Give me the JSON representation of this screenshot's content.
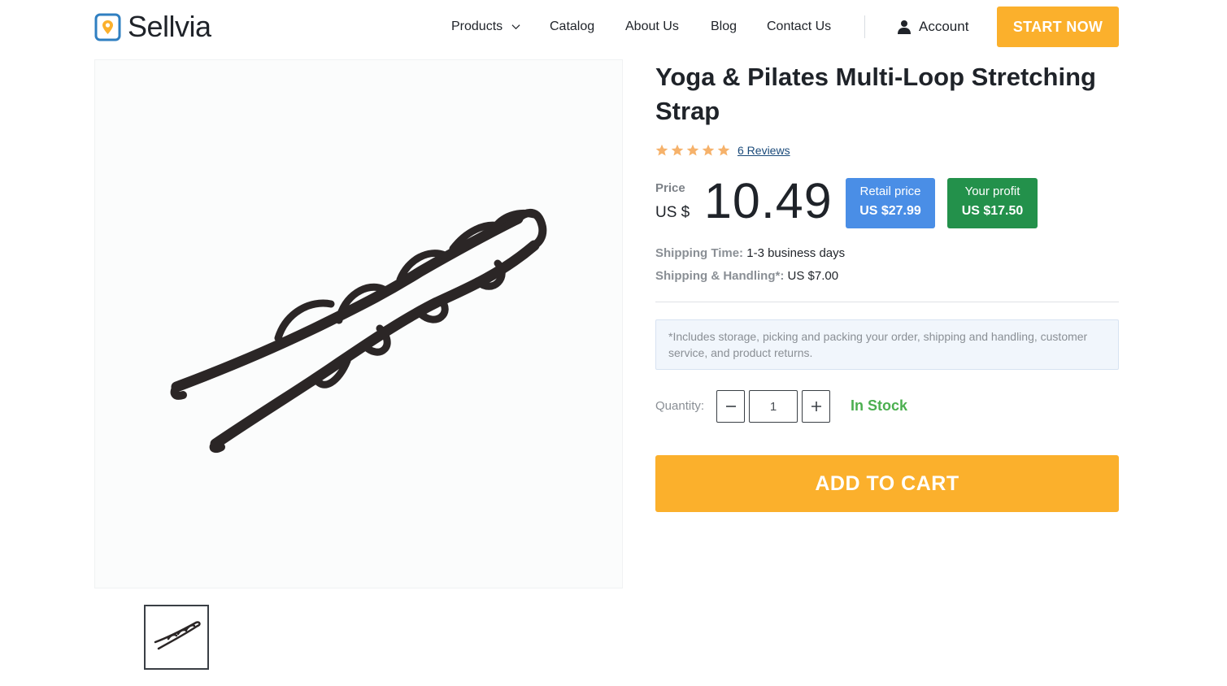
{
  "header": {
    "logo_text": "Sellvia",
    "nav": [
      {
        "label": "Products"
      },
      {
        "label": "Catalog"
      },
      {
        "label": "About Us"
      },
      {
        "label": "Blog"
      },
      {
        "label": "Contact Us"
      }
    ],
    "account_label": "Account",
    "start_label": "START NOW"
  },
  "product": {
    "title": "Yoga & Pilates Multi-Loop Stretching Strap",
    "rating": 5,
    "rating_max": 5,
    "reviews_label": "6 Reviews",
    "price_label": "Price",
    "currency": "US $",
    "price": "10.49",
    "retail_label": "Retail price",
    "retail_value": "US $27.99",
    "profit_label": "Your profit",
    "profit_value": "US $17.50",
    "shipping_time_label": "Shipping Time:",
    "shipping_time_value": "1-3 business days",
    "shipping_handling_label": "Shipping & Handling*:",
    "shipping_handling_value": "US $7.00",
    "note": "*Includes storage, picking and packing your order, shipping and handling, customer service, and product returns.",
    "quantity_label": "Quantity:",
    "quantity_value": "1",
    "stock_status": "In Stock",
    "add_to_cart_label": "ADD TO CART"
  },
  "colors": {
    "accent_orange": "#fbb02c",
    "retail_blue": "#4a8ee6",
    "profit_green": "#23914b",
    "stock_green": "#4caf50",
    "star": "#f6b26b"
  }
}
